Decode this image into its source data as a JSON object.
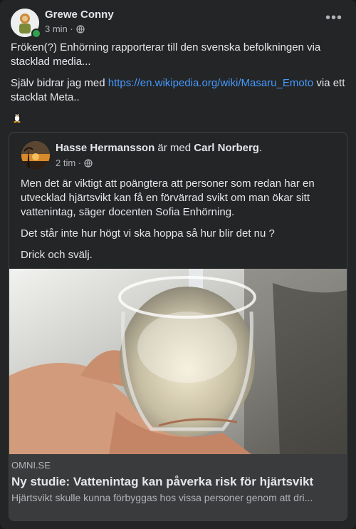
{
  "post": {
    "author": "Grewe Conny",
    "time": "3 min ·",
    "more_label": "•••",
    "text_line1": "Fröken(?) Enhörning rapporterar till den svenska befolkningen via stacklad media...",
    "text_pre_link": "Själv bidrar jag med ",
    "link": "https://en.wikipedia.org/wiki/Masaru_Emoto",
    "text_post_link": " via ett stacklat Meta..",
    "emoji": "penguin-icon",
    "icons": {
      "privacy": "globe-icon",
      "online": "online-status-dot"
    },
    "colors": {
      "background": "#242526",
      "link": "#4599ff",
      "online": "#31a24c"
    }
  },
  "shared": {
    "author": "Hasse Hermansson",
    "with_text": " är med ",
    "tagged": "Carl Norberg",
    "period": ".",
    "time": "2 tim ·",
    "paragraphs": [
      "Men det är viktigt att poängtera att personer som redan har en utvecklad hjärtsvikt kan få en förvärrad svikt om man ökar sitt vattenintag, säger docenten Sofia Enhörning.",
      "Det står inte hur högt vi ska hoppa så hur blir det nu ?",
      "Drick och svälj."
    ],
    "link_preview": {
      "image": "glass-of-water-photo",
      "domain": "OMNI.SE",
      "title": "Ny studie: Vattenintag kan påverka risk för hjärtsvikt",
      "description": "Hjärtsvikt skulle kunna förbyggas hos vissa personer genom att dri..."
    }
  }
}
